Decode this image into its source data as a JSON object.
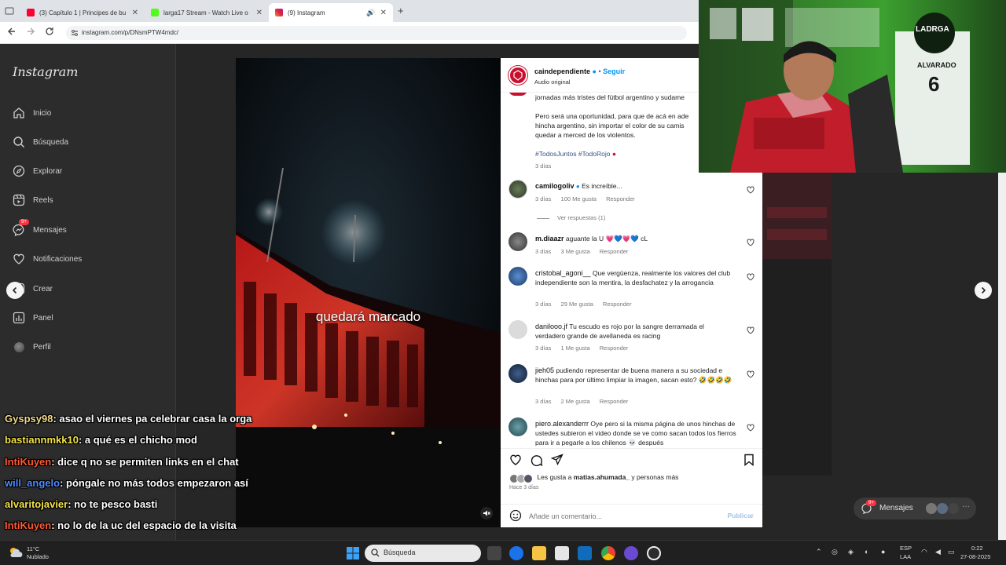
{
  "browser": {
    "tabs": [
      {
        "title": "(3) Capítulo 1 | Principes de bu",
        "icon_color": "#ff0033",
        "active": false
      },
      {
        "title": "larga17 Stream - Watch Live o",
        "icon_color": "#53fc18",
        "active": false
      },
      {
        "title": "(9) Instagram",
        "icon_color": "#d62976",
        "active": true
      }
    ],
    "new_tab": "+",
    "url": "instagram.com/p/DNsmPTW4mdc/"
  },
  "instagram": {
    "logo": "Instagram",
    "nav": [
      {
        "label": "Inicio",
        "icon": "home-icon"
      },
      {
        "label": "Búsqueda",
        "icon": "search-icon"
      },
      {
        "label": "Explorar",
        "icon": "compass-icon"
      },
      {
        "label": "Reels",
        "icon": "reels-icon"
      },
      {
        "label": "Mensajes",
        "icon": "messenger-icon",
        "badge": "9+"
      },
      {
        "label": "Notificaciones",
        "icon": "heart-icon"
      },
      {
        "label": "Crear",
        "icon": "plus-icon"
      },
      {
        "label": "Panel",
        "icon": "dashboard-icon"
      },
      {
        "label": "Perfil",
        "icon": "avatar"
      }
    ],
    "video_caption": "quedará marcado",
    "post": {
      "author": "caindependiente",
      "follow": "Seguir",
      "audio": "Audio original",
      "caption_lines": [
        "jornadas más tristes del fútbol argentino y sudame",
        "Pero será una oportunidad, para que de acá en ade",
        "hincha argentino, sin importar el color de su camis",
        "quedar a merced de los violentos."
      ],
      "hashtags": "#TodosJuntos #TodoRojo",
      "caption_age": "3 días",
      "comments": [
        {
          "user": "camilogoliv",
          "verified": true,
          "text": "Es increíble...",
          "age": "3 días",
          "likes": "100 Me gusta",
          "reply": "Responder",
          "replies": "Ver respuestas (1)"
        },
        {
          "user": "m.diaazr",
          "text": "aguante la U 💗💙💗💙 cL",
          "age": "3 días",
          "likes": "3 Me gusta",
          "reply": "Responder"
        },
        {
          "user": "cristobal_agoni__",
          "text": "Que vergüenza, realmente los valores del club independiente son la mentira, la desfachatez y la arrogancia",
          "age": "3 días",
          "likes": "29 Me gusta",
          "reply": "Responder"
        },
        {
          "user": "danilooo.jf",
          "text": "Tu escudo es rojo por la sangre derramada el verdadero grande de avellaneda es racing",
          "age": "3 días",
          "likes": "1 Me gusta",
          "reply": "Responder"
        },
        {
          "user": "jieh05",
          "text": "pudiendo representar de buena manera a su sociedad e hinchas para por último limpiar la imagen, sacan esto? 🤣🤣🤣🤣",
          "age": "3 días",
          "likes": "2 Me gusta",
          "reply": "Responder"
        },
        {
          "user": "piero.alexanderrr",
          "text": "Oye pero si la misma página de unos hinchas de ustedes subieron el video donde se ve como sacan todos los fierros para ir a pegarle a los chilenos 💀 después",
          "age": "",
          "likes": "",
          "reply": ""
        }
      ],
      "liked_by_prefix": "Les gusta a",
      "liked_by_user": "matias.ahumada_",
      "liked_by_suffix": "y personas más",
      "post_age": "Hace 3 días",
      "add_comment_placeholder": "Añade un comentario...",
      "publish": "Publicar"
    },
    "dim_overlay": {
      "messages_pill": "Mensajes",
      "messages_badge": "9+"
    }
  },
  "webcam": {
    "brand": "LADRGA",
    "jersey_name": "ALVARADO",
    "jersey_number": "6"
  },
  "chat": [
    {
      "user": "Gyspsy98",
      "color": "#f3d98a",
      "text": ": asao el viernes pa celebrar casa la orga"
    },
    {
      "user": "bastiannmkk10",
      "color": "#f3e34a",
      "text": ": a qué es el chicho mod"
    },
    {
      "user": "IntiKuyen",
      "color": "#ff5a36",
      "text": ": dice q no se permiten links en el chat"
    },
    {
      "user": "will_angelo",
      "color": "#4d8bff",
      "text": ": póngale no más todos empezaron así"
    },
    {
      "user": "alvaritojavier",
      "color": "#f3e34a",
      "text": ": no te pesco basti"
    },
    {
      "user": "IntiKuyen",
      "color": "#ff5a36",
      "text": ": no lo de la uc del espacio de la visita"
    }
  ],
  "taskbar": {
    "weather_temp": "11°C",
    "weather_desc": "Nublado",
    "search_placeholder": "Búsqueda",
    "lang_top": "ESP",
    "lang_bottom": "LAA",
    "time": "0:22",
    "date": "27-08-2025"
  }
}
